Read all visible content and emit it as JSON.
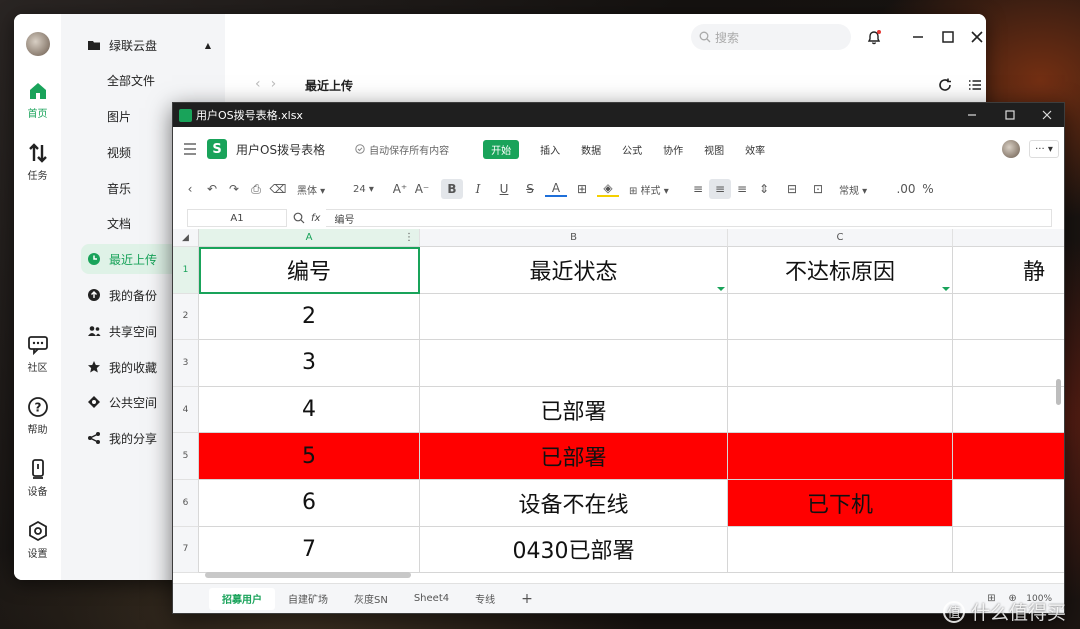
{
  "nas": {
    "rail": [
      {
        "label": "首页",
        "icon": "home-icon",
        "active": true
      },
      {
        "label": "任务",
        "icon": "transfer-icon",
        "active": false
      },
      {
        "label": "社区",
        "icon": "community-icon",
        "active": false
      },
      {
        "label": "帮助",
        "icon": "help-icon",
        "active": false
      },
      {
        "label": "设备",
        "icon": "device-icon",
        "active": false
      },
      {
        "label": "设置",
        "icon": "settings-icon",
        "active": false
      }
    ],
    "nav": [
      {
        "label": "绿联云盘",
        "icon": "folder-icon"
      },
      {
        "label": "全部文件"
      },
      {
        "label": "图片"
      },
      {
        "label": "视频"
      },
      {
        "label": "音乐"
      },
      {
        "label": "文档"
      },
      {
        "label": "最近上传",
        "icon": "clock-icon",
        "active": true
      },
      {
        "label": "我的备份",
        "icon": "backup-icon"
      },
      {
        "label": "共享空间",
        "icon": "share-space-icon"
      },
      {
        "label": "我的收藏",
        "icon": "star-icon"
      },
      {
        "label": "公共空间",
        "icon": "public-space-icon"
      },
      {
        "label": "我的分享",
        "icon": "share-icon"
      }
    ],
    "search_placeholder": "搜索",
    "breadcrumb": "最近上传",
    "accent": "#19a35a"
  },
  "spreadsheet": {
    "window_title": "用户OS拨号表格.xlsx",
    "doc_title": "用户OS拨号表格",
    "autosave": "自动保存所有内容",
    "menu_tabs": [
      "开始",
      "插入",
      "数据",
      "公式",
      "协作",
      "视图",
      "效率"
    ],
    "toolbar": {
      "font": "黑体",
      "size": "24",
      "style": "样式",
      "number_format": "常规"
    },
    "namebox": "A1",
    "fx_label": "fx",
    "formula": "编号",
    "columns": [
      "A",
      "B",
      "C"
    ],
    "rows": [
      {
        "num": "1",
        "cells": [
          "编号",
          "最近状态",
          "不达标原因",
          "静"
        ],
        "red": [
          false,
          false,
          false,
          false
        ]
      },
      {
        "num": "2",
        "cells": [
          "2",
          "",
          "",
          ""
        ],
        "red": [
          false,
          false,
          false,
          false
        ]
      },
      {
        "num": "3",
        "cells": [
          "3",
          "",
          "",
          ""
        ],
        "red": [
          false,
          false,
          false,
          false
        ]
      },
      {
        "num": "4",
        "cells": [
          "4",
          "已部署",
          "",
          ""
        ],
        "red": [
          false,
          false,
          false,
          false
        ]
      },
      {
        "num": "5",
        "cells": [
          "5",
          "已部署",
          "",
          ""
        ],
        "red": [
          true,
          true,
          true,
          true
        ]
      },
      {
        "num": "6",
        "cells": [
          "6",
          "设备不在线",
          "已下机",
          ""
        ],
        "red": [
          false,
          false,
          true,
          false
        ]
      },
      {
        "num": "7",
        "cells": [
          "7",
          "0430已部署",
          "",
          ""
        ],
        "red": [
          false,
          false,
          false,
          false
        ]
      }
    ],
    "sheets": [
      "招募用户",
      "自建矿场",
      "灰度SN",
      "Sheet4",
      "专线"
    ],
    "add_sheet": "+",
    "zoom": "100%"
  },
  "watermark": {
    "icon": "值",
    "text": "什么值得买"
  }
}
